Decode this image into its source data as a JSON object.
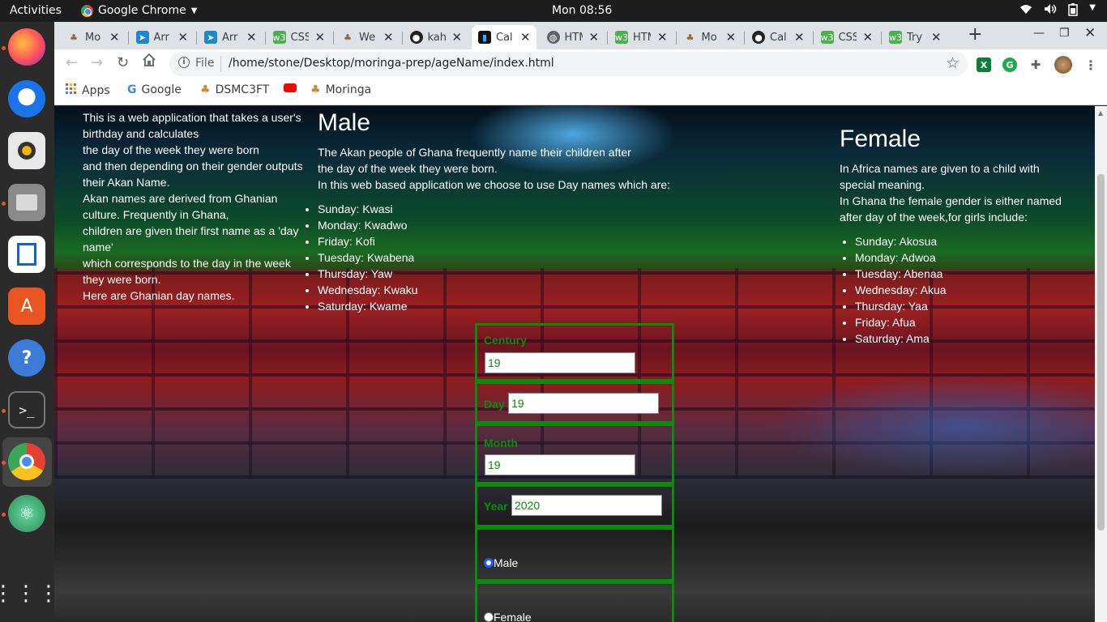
{
  "topbar": {
    "activities": "Activities",
    "app_name": "Google Chrome",
    "clock": "Mon 08:56"
  },
  "dock": {
    "items": [
      "firefox-icon",
      "thunderbird-icon",
      "rhythmbox-icon",
      "files-icon",
      "writer-icon",
      "software-icon",
      "help-icon",
      "terminal-icon",
      "chrome-icon",
      "atom-icon",
      "app-grid-icon"
    ]
  },
  "tabs": [
    {
      "label": "Mo",
      "icon": "moringa-icon"
    },
    {
      "label": "Arr",
      "icon": "arrow-icon"
    },
    {
      "label": "Arr",
      "icon": "arrow-icon"
    },
    {
      "label": "CSS",
      "icon": "w3-icon"
    },
    {
      "label": "We",
      "icon": "moringa-icon"
    },
    {
      "label": "kah",
      "icon": "github-icon"
    },
    {
      "label": "Cal",
      "icon": "terminal-icon"
    },
    {
      "label": "HTM",
      "icon": "globe-icon"
    },
    {
      "label": "HTM",
      "icon": "w3-icon"
    },
    {
      "label": "Mo",
      "icon": "moringa-icon"
    },
    {
      "label": "Cal",
      "icon": "github-icon"
    },
    {
      "label": "CSS",
      "icon": "w3-icon"
    },
    {
      "label": "Try",
      "icon": "w3-icon"
    }
  ],
  "active_tab_index": 6,
  "address": {
    "scheme": "File",
    "url": "/home/stone/Desktop/moringa-prep/ageName/index.html"
  },
  "bookmarks": [
    {
      "label": "Apps",
      "icon": "apps-grid-icon"
    },
    {
      "label": "Google",
      "icon": "google-icon"
    },
    {
      "label": "DSMC3FT",
      "icon": "moringa-icon"
    },
    {
      "label": "",
      "icon": "youtube-icon"
    },
    {
      "label": "Moringa",
      "icon": "moringa-icon"
    }
  ],
  "intro": {
    "lines": [
      "This is a web application that takes a user's birthday and calculates",
      "the day of the week they were born",
      "and then depending on their gender outputs their Akan Name.",
      "Akan names are derived from Ghanian culture. Frequently in Ghana,",
      "children are given their first name as a 'day name'",
      "which corresponds to the day in the week they were born.",
      "Here are Ghanian day names."
    ]
  },
  "male": {
    "heading": "Male",
    "lines": [
      "The Akan people of Ghana frequently name their children after",
      "the day of the week they were born.",
      "In this web based application we choose to use Day names which are:"
    ],
    "names": [
      "Sunday: Kwasi",
      "Monday: Kwadwo",
      "Friday: Kofi",
      "Tuesday: Kwabena",
      "Thursday: Yaw",
      "Wednesday: Kwaku",
      "Saturday: Kwame"
    ]
  },
  "female": {
    "heading": "Female",
    "lines": [
      "In Africa names are given to a child with special meaning.",
      "In Ghana the female gender is either named after day of the week,for girls include:"
    ],
    "names": [
      "Sunday: Akosua",
      "Monday: Adwoa",
      "Tuesday: Abenaa",
      "Wednesday: Akua",
      "Thursday: Yaa",
      "Friday: Afua",
      "Saturday: Ama"
    ]
  },
  "form": {
    "century_label": "Century",
    "century_value": "19",
    "day_label": "Day",
    "day_value": "19",
    "month_label": "Month",
    "month_value": "19",
    "year_label": "Year",
    "year_value": "2020",
    "male_label": "Male",
    "female_label": "Female",
    "selected_gender": "Male"
  }
}
